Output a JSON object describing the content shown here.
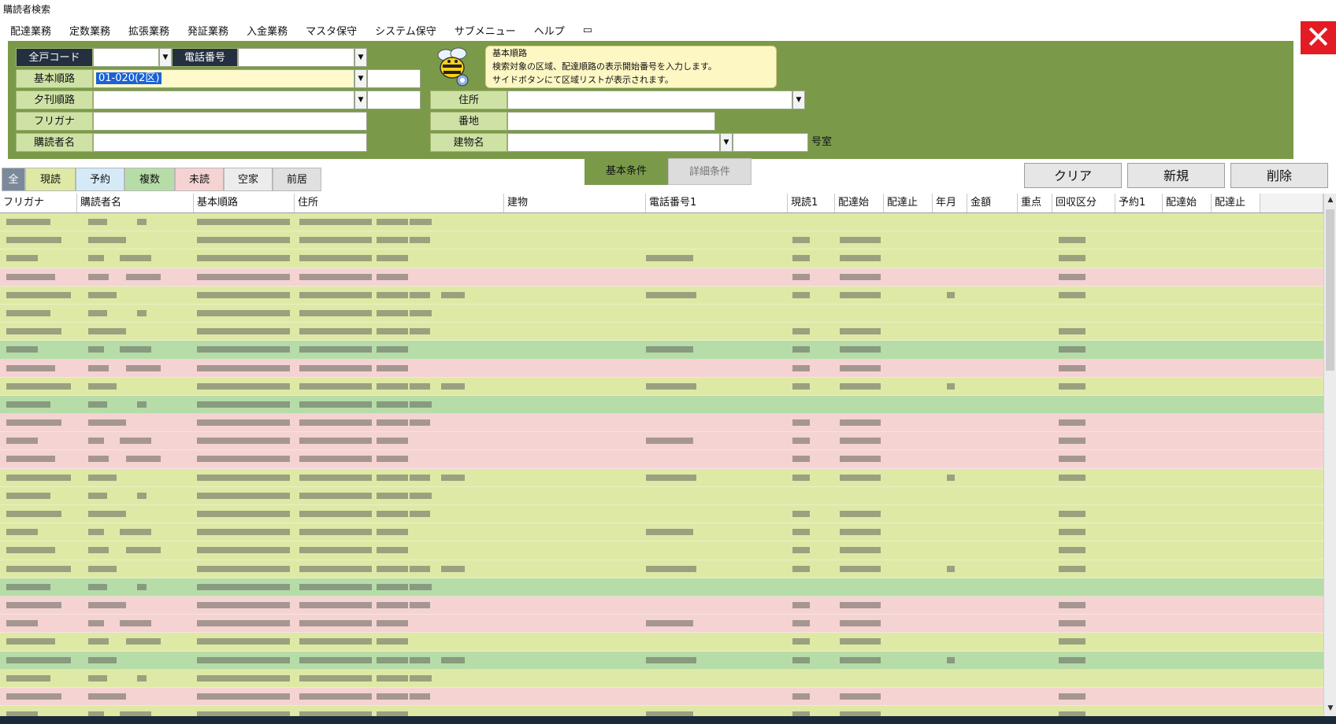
{
  "window": {
    "title": "購読者検索",
    "close_label": "✕"
  },
  "menu": [
    "配達業務",
    "定数業務",
    "拡張業務",
    "発証業務",
    "入金業務",
    "マスタ保守",
    "システム保守",
    "サブメニュー",
    "ヘルプ",
    "▭"
  ],
  "search": {
    "label_household": "全戸コード",
    "label_phone": "電話番号",
    "label_route": "基本順路",
    "route_value": "01-020(2区)",
    "label_evening": "夕刊順路",
    "label_furigana": "フリガナ",
    "label_subscriber": "購読者名",
    "label_address": "住所",
    "label_banchi": "番地",
    "label_building": "建物名",
    "room_suffix": "号室"
  },
  "tooltip": {
    "title": "基本順路",
    "line1": "検索対象の区域、配達順路の表示開始番号を入力します。",
    "line2": "サイドボタンにて区域リストが表示されます。"
  },
  "filter_tabs": [
    "全",
    "現読",
    "予約",
    "複数",
    "未読",
    "空家",
    "前居"
  ],
  "condition_tabs": {
    "basic": "基本条件",
    "detail": "詳細条件"
  },
  "actions": {
    "clear": "クリア",
    "new": "新規",
    "delete": "削除"
  },
  "columns": [
    "フリガナ",
    "購読者名",
    "基本順路",
    "住所",
    "建物",
    "電話番号1",
    "現読1",
    "配達始",
    "配達止",
    "年月",
    "金額",
    "重点",
    "回収区分",
    "予約1",
    "配達始",
    "配達止"
  ],
  "row_types": [
    "y",
    "y",
    "y",
    "p",
    "y",
    "y",
    "y",
    "g",
    "p",
    "y",
    "g",
    "p",
    "p",
    "p",
    "y",
    "y",
    "y",
    "y",
    "y",
    "y",
    "g",
    "p",
    "p",
    "y",
    "g",
    "y",
    "p",
    "y",
    "y"
  ],
  "colors": {
    "yellow_row": "#dfe9a6",
    "pink_row": "#f5d3d3",
    "green_row": "#b6dca8",
    "panel": "#7a9a4a",
    "dark_label": "#243040",
    "light_label": "#cfe2a6",
    "close": "#e41b23"
  }
}
